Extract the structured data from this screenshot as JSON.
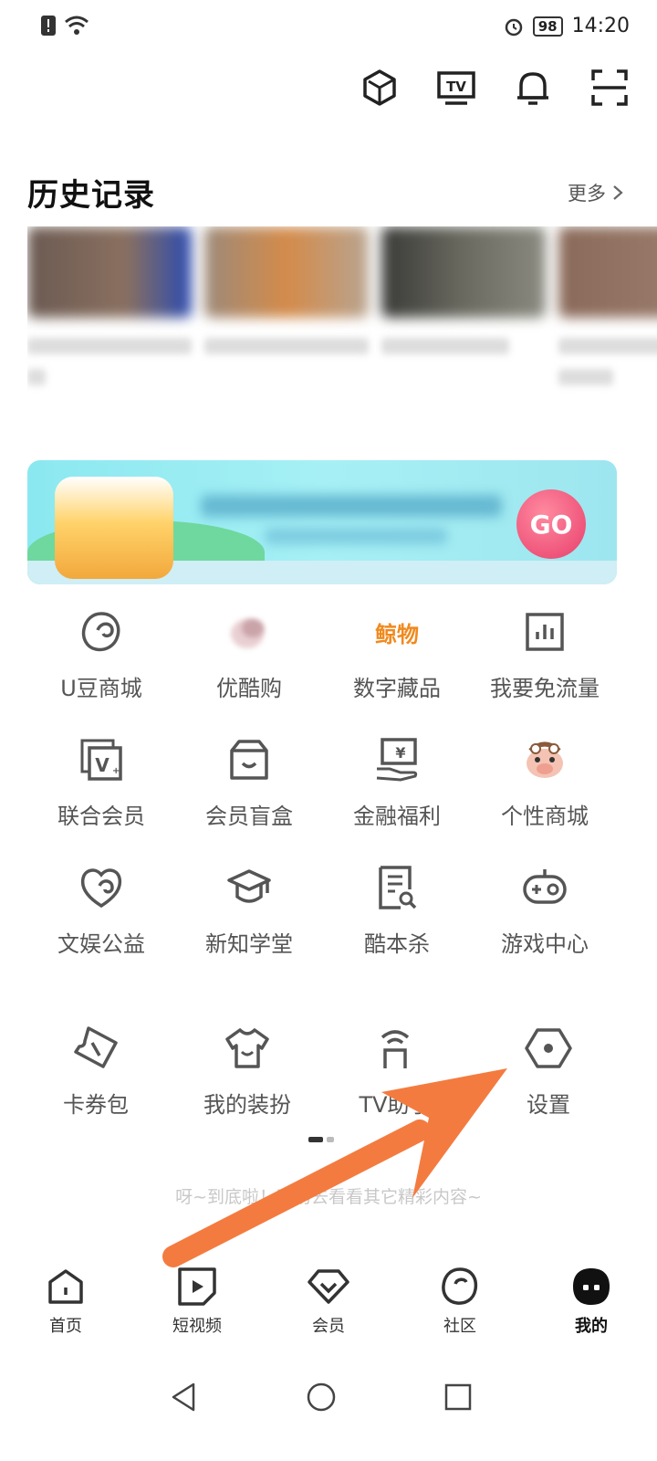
{
  "status_bar": {
    "time": "14:20",
    "battery": "98"
  },
  "top_icons": [
    "cube-icon",
    "tv-icon",
    "bell-icon",
    "scan-icon"
  ],
  "history": {
    "title": "历史记录",
    "more": "更多"
  },
  "banner": {
    "go_label": "GO"
  },
  "grid": [
    {
      "label": "U豆商城",
      "icon": "bean-icon"
    },
    {
      "label": "优酷购",
      "icon": "youku-shop-icon"
    },
    {
      "label": "数字藏品",
      "icon": "digital-collection-icon",
      "icon_text": "鲸物"
    },
    {
      "label": "我要免流量",
      "icon": "data-flow-icon"
    },
    {
      "label": "联合会员",
      "icon": "joint-vip-icon"
    },
    {
      "label": "会员盲盒",
      "icon": "blind-box-icon"
    },
    {
      "label": "金融福利",
      "icon": "finance-icon"
    },
    {
      "label": "个性商城",
      "icon": "mascot-icon"
    },
    {
      "label": "文娱公益",
      "icon": "charity-icon"
    },
    {
      "label": "新知学堂",
      "icon": "graduation-cap-icon"
    },
    {
      "label": "酷本杀",
      "icon": "script-icon"
    },
    {
      "label": "游戏中心",
      "icon": "gamepad-icon"
    },
    {
      "label": "卡券包",
      "icon": "ticket-icon"
    },
    {
      "label": "我的装扮",
      "icon": "tshirt-icon"
    },
    {
      "label": "TV助手",
      "icon": "tv-assistant-icon"
    },
    {
      "label": "设置",
      "icon": "settings-icon"
    }
  ],
  "bottom_tip": "呀~到底啦！不妨去看看其它精彩内容~",
  "tabs": [
    {
      "label": "首页",
      "icon": "home-icon"
    },
    {
      "label": "短视频",
      "icon": "play-icon"
    },
    {
      "label": "会员",
      "icon": "vip-icon"
    },
    {
      "label": "社区",
      "icon": "community-icon"
    },
    {
      "label": "我的",
      "icon": "profile-icon"
    }
  ],
  "active_tab": "我的",
  "colors": {
    "accent_arrow": "#f47b3f",
    "text_gray": "#555555"
  }
}
